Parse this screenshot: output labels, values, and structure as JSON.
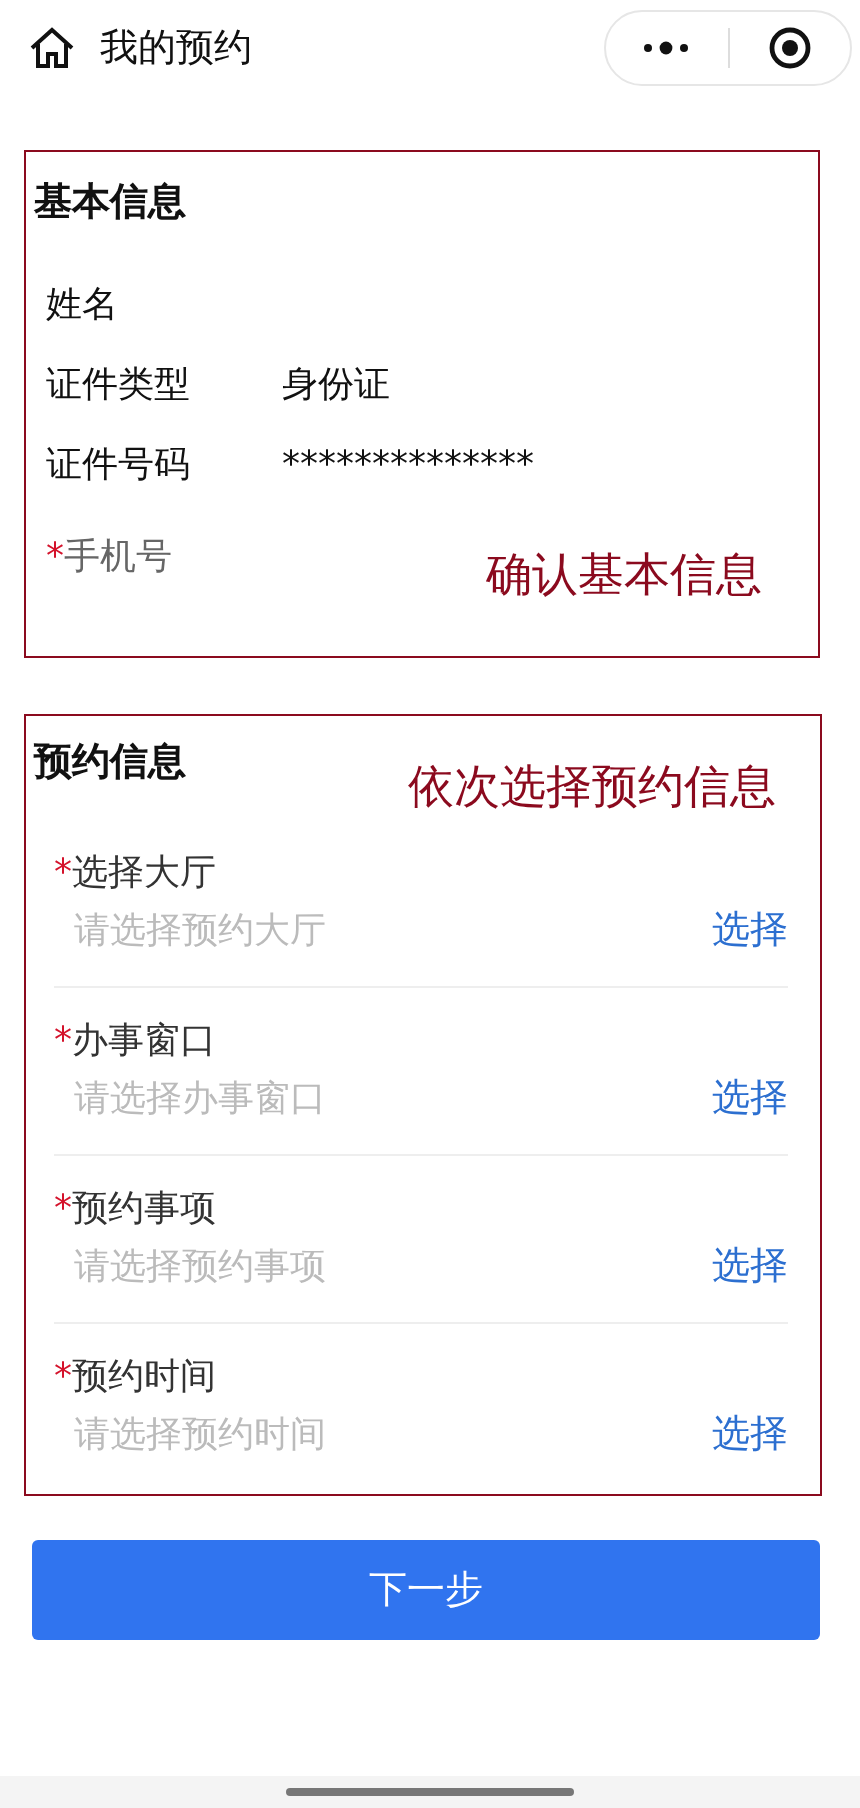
{
  "header": {
    "title": "我的预约"
  },
  "basic_info": {
    "title": "基本信息",
    "note": "确认基本信息",
    "rows": [
      {
        "label": "姓名"
      },
      {
        "label": "证件类型",
        "value": "身份证"
      },
      {
        "label": "证件号码",
        "value": "**************"
      }
    ],
    "phone": {
      "mark": "*",
      "label": "手机号"
    }
  },
  "appointment": {
    "title": "预约信息",
    "note": "依次选择预约信息",
    "fields": [
      {
        "mark": "*",
        "label": "选择大厅",
        "placeholder": "请选择预约大厅",
        "action": "选择"
      },
      {
        "mark": "*",
        "label": "办事窗口",
        "placeholder": "请选择办事窗口",
        "action": "选择"
      },
      {
        "mark": "*",
        "label": "预约事项",
        "placeholder": "请选择预约事项",
        "action": "选择"
      },
      {
        "mark": "*",
        "label": "预约时间",
        "placeholder": "请选择预约时间",
        "action": "选择"
      }
    ]
  },
  "next_button": "下一步"
}
